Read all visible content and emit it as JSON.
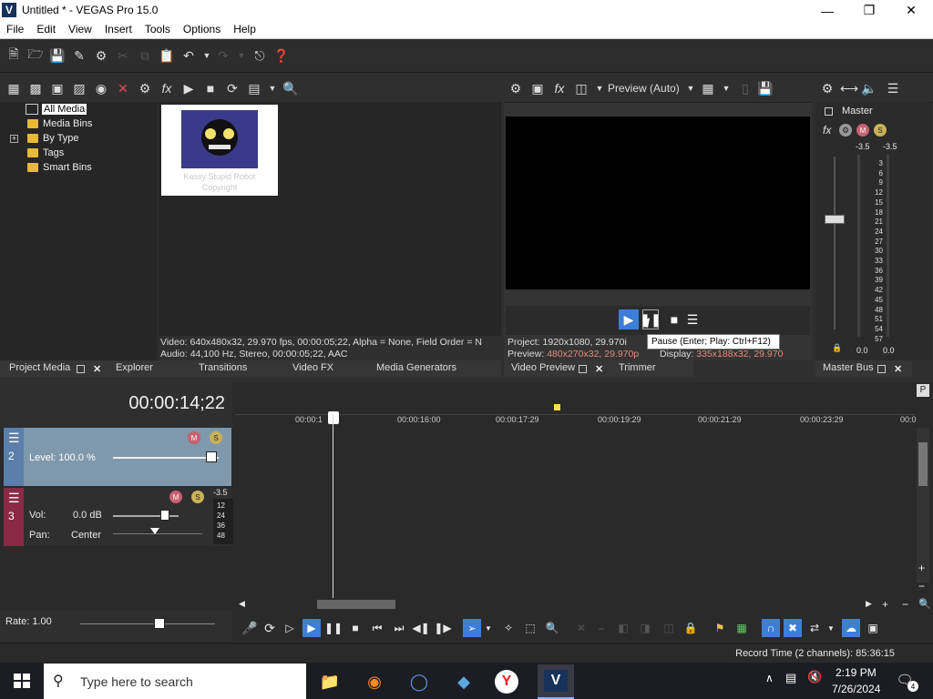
{
  "window": {
    "logo": "V",
    "title": "Untitled * - VEGAS Pro 15.0"
  },
  "menu": [
    "File",
    "Edit",
    "View",
    "Insert",
    "Tools",
    "Options",
    "Help"
  ],
  "media_tree": [
    "All Media",
    "Media Bins",
    "By Type",
    "Tags",
    "Smart Bins"
  ],
  "media": {
    "clip_caption": "Kassy Stupid Robot Copyright",
    "info_video": "Video: 640x480x32, 29.970 fps, 00:00:05;22, Alpha = None, Field Order = N",
    "info_audio": "Audio: 44,100 Hz, Stereo, 00:00:05;22, AAC"
  },
  "left_tabs": [
    "Project Media",
    "Explorer",
    "Transitions",
    "Video FX",
    "Media Generators"
  ],
  "preview": {
    "mode_label": "Preview (Auto)",
    "tooltip": "Pause (Enter; Play: Ctrl+F12)",
    "project_label": "Project:",
    "project_value": "1920x1080, 29.970i",
    "preview_label": "Preview:",
    "preview_value": "480x270x32, 29.970p",
    "display_label": "Display:",
    "display_value": "335x188x32, 29.970"
  },
  "preview_tabs": [
    "Video Preview",
    "Trimmer"
  ],
  "master": {
    "label": "Master",
    "peak_left": "-3.5",
    "peak_right": "-3.5",
    "scale": [
      "3",
      "6",
      "9",
      "12",
      "15",
      "18",
      "21",
      "24",
      "27",
      "30",
      "33",
      "36",
      "39",
      "42",
      "45",
      "48",
      "51",
      "54",
      "57"
    ],
    "foot_left": "0.0",
    "foot_right": "0.0",
    "tab": "Master Bus"
  },
  "timeline": {
    "timecode": "00:00:14;22",
    "ruler": [
      "00:00:1",
      "00:00:16:00",
      "00:00:17:29",
      "00:00:19:29",
      "00:00:21:29",
      "00:00:23:29",
      "00:0"
    ]
  },
  "track2": {
    "number": "2",
    "level": "Level: 100.0 %"
  },
  "track3": {
    "number": "3",
    "vol_label": "Vol:",
    "vol_value": "0.0 dB",
    "pan_label": "Pan:",
    "pan_value": "Center",
    "meter_top": "-3.5",
    "meter_scale": [
      "12",
      "24",
      "36",
      "48"
    ]
  },
  "transport": {
    "rate": "Rate: 1.00"
  },
  "status": {
    "record_time": "Record Time (2 channels): 85:36:15"
  },
  "taskbar": {
    "search_placeholder": "Type here to search",
    "time": "2:19 PM",
    "date": "7/26/2024",
    "notification_count": "4"
  },
  "colors": {
    "accent": "#3d7fd6",
    "track2": "#7f98ab",
    "track3_strip": "#8b2a44",
    "title_bg": "#ffffff"
  }
}
